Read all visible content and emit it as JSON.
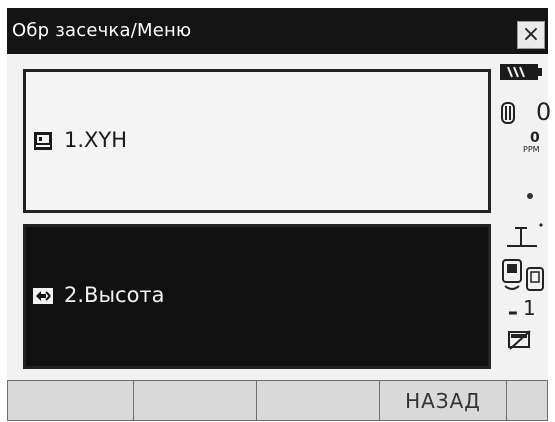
{
  "title": "Обр засечка/Меню",
  "close_label": "×",
  "menu": [
    {
      "label": "1.XYH",
      "icon": "book-icon",
      "selected": false
    },
    {
      "label": "2.Высота",
      "icon": "height-icon",
      "selected": true
    }
  ],
  "status": {
    "battery_icon": "battery-icon",
    "prism_constant": "0",
    "ppm_value": "0",
    "ppm_unit": "PPM",
    "target_icon": "target-prism-icon",
    "tilt_icon": "tilt-icon",
    "communication_icon": "bluetooth-communication-icon",
    "face_indicator": "1",
    "no_memory_icon": "memory-card-icon"
  },
  "softkeys": [
    "",
    "",
    "",
    "НАЗАД",
    ""
  ]
}
